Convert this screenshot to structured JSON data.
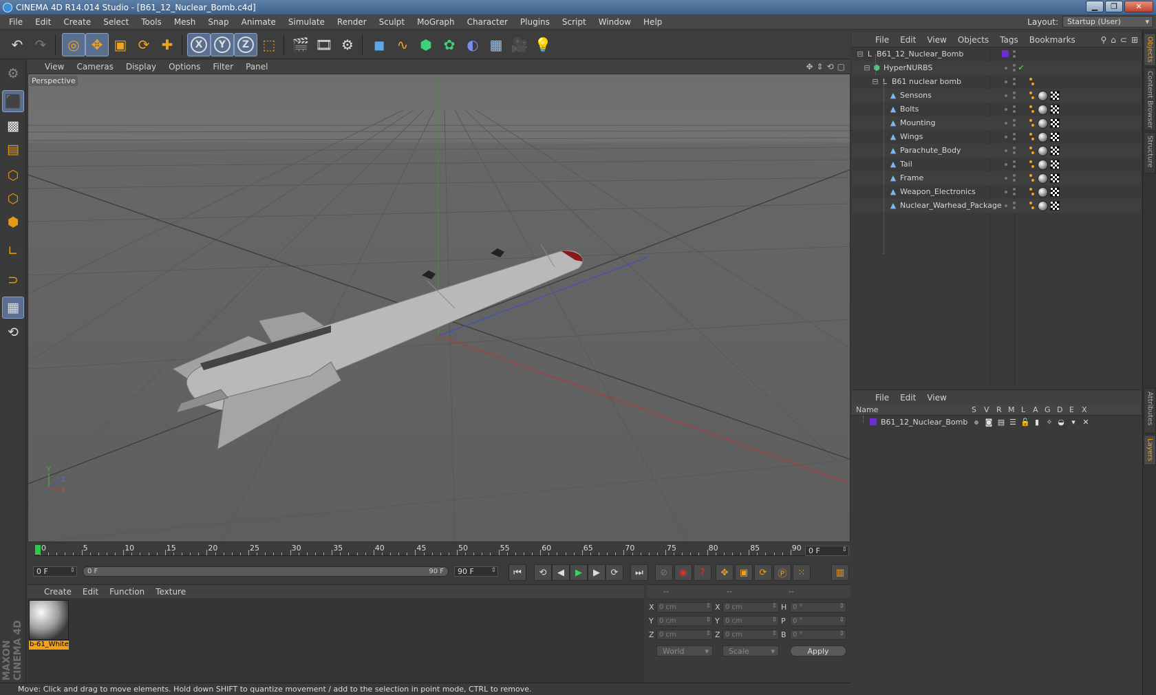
{
  "window": {
    "title": "CINEMA 4D R14.014 Studio - [B61_12_Nuclear_Bomb.c4d]",
    "minimize": "▁",
    "maximize": "❐",
    "close": "✕"
  },
  "menubar": [
    "File",
    "Edit",
    "Create",
    "Select",
    "Tools",
    "Mesh",
    "Snap",
    "Animate",
    "Simulate",
    "Render",
    "Sculpt",
    "MoGraph",
    "Character",
    "Plugins",
    "Script",
    "Window",
    "Help"
  ],
  "layout": {
    "label": "Layout:",
    "value": "Startup (User)"
  },
  "toolbar": {
    "axis_x": "X",
    "axis_y": "Y",
    "axis_z": "Z"
  },
  "viewport": {
    "menus": [
      "View",
      "Cameras",
      "Display",
      "Options",
      "Filter",
      "Panel"
    ],
    "label": "Perspective",
    "axis_letters": {
      "y": "Y",
      "z": "Z",
      "x": "X"
    }
  },
  "timeline": {
    "ticks": [
      "0",
      "5",
      "10",
      "15",
      "20",
      "25",
      "30",
      "35",
      "40",
      "45",
      "50",
      "55",
      "60",
      "65",
      "70",
      "75",
      "80",
      "85",
      "90"
    ],
    "current_frame": "0 F",
    "start_frame": "0 F",
    "range_start": "0 F",
    "range_end": "90 F",
    "end_frame": "90 F"
  },
  "material_manager": {
    "menus": [
      "Create",
      "Edit",
      "Function",
      "Texture"
    ],
    "materials": [
      {
        "name": "b-61_White"
      }
    ]
  },
  "coordinates": {
    "headers": [
      "--",
      "--",
      "--"
    ],
    "rows": [
      {
        "l1": "X",
        "v1": "0 cm",
        "l2": "X",
        "v2": "0 cm",
        "l3": "H",
        "v3": "0 °"
      },
      {
        "l1": "Y",
        "v1": "0 cm",
        "l2": "Y",
        "v2": "0 cm",
        "l3": "P",
        "v3": "0 °"
      },
      {
        "l1": "Z",
        "v1": "0 cm",
        "l2": "Z",
        "v2": "0 cm",
        "l3": "B",
        "v3": "0 °"
      }
    ],
    "world": "World",
    "scale": "Scale",
    "apply": "Apply"
  },
  "status": "Move: Click and drag to move elements. Hold down SHIFT to quantize movement / add to the selection in point mode, CTRL to remove.",
  "objects_manager": {
    "menus": [
      "File",
      "Edit",
      "View",
      "Objects",
      "Tags",
      "Bookmarks"
    ],
    "tree": [
      {
        "name": "B61_12_Nuclear_Bomb",
        "level": 0,
        "kind": "null"
      },
      {
        "name": "HyperNURBS",
        "level": 1,
        "kind": "nurbs"
      },
      {
        "name": "B61 nuclear bomb",
        "level": 2,
        "kind": "null"
      },
      {
        "name": "Sensons",
        "level": 3,
        "kind": "poly"
      },
      {
        "name": "Bolts",
        "level": 3,
        "kind": "poly"
      },
      {
        "name": "Mounting",
        "level": 3,
        "kind": "poly"
      },
      {
        "name": "Wings",
        "level": 3,
        "kind": "poly"
      },
      {
        "name": "Parachute_Body",
        "level": 3,
        "kind": "poly"
      },
      {
        "name": "Tail",
        "level": 3,
        "kind": "poly"
      },
      {
        "name": "Frame",
        "level": 3,
        "kind": "poly"
      },
      {
        "name": "Weapon_Electronics",
        "level": 3,
        "kind": "poly"
      },
      {
        "name": "Nuclear_Warhead_Package",
        "level": 3,
        "kind": "poly"
      }
    ],
    "check_mark": "✔"
  },
  "layers_manager": {
    "menus": [
      "File",
      "Edit",
      "View"
    ],
    "columns": [
      "Name",
      "S",
      "V",
      "R",
      "M",
      "L",
      "A",
      "G",
      "D",
      "E",
      "X"
    ],
    "layers": [
      {
        "name": "B61_12_Nuclear_Bomb",
        "color": "#6a2ed8"
      }
    ]
  },
  "side_tabs": [
    "Objects",
    "Content Browser",
    "Structure",
    "Attributes",
    "Layers"
  ],
  "branding": "MAXON CINEMA 4D",
  "colors": {
    "accent": "#f3a21b",
    "selection": "#5a6e90",
    "layer_purple": "#6a2ed8"
  }
}
